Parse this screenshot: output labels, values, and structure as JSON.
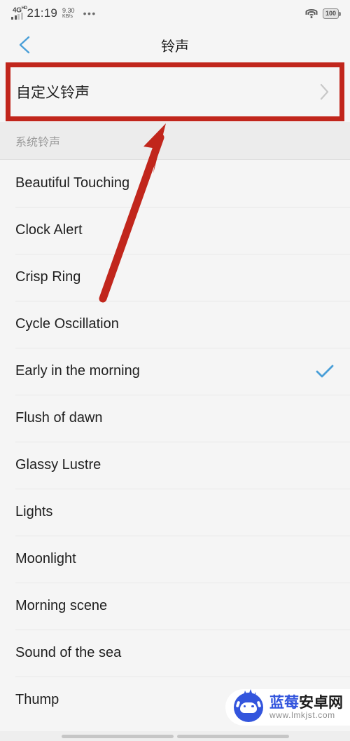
{
  "status_bar": {
    "network_type": "4G",
    "network_type_sup": "HD",
    "time": "21:19",
    "net_speed_value": "9.30",
    "net_speed_unit": "KB/s",
    "overflow_dots": "•••",
    "battery_level": "100"
  },
  "header": {
    "title": "铃声",
    "back_icon": "chevron-left-icon"
  },
  "custom_ringtone": {
    "label": "自定义铃声",
    "chevron_icon": "chevron-right-icon",
    "highlight_color": "#c1261c"
  },
  "section": {
    "title": "系统铃声"
  },
  "ringtones": [
    {
      "name": "Beautiful Touching",
      "selected": false
    },
    {
      "name": "Clock Alert",
      "selected": false
    },
    {
      "name": "Crisp Ring",
      "selected": false
    },
    {
      "name": "Cycle Oscillation",
      "selected": false
    },
    {
      "name": "Early in the morning",
      "selected": true
    },
    {
      "name": "Flush of dawn",
      "selected": false
    },
    {
      "name": "Glassy Lustre",
      "selected": false
    },
    {
      "name": "Lights",
      "selected": false
    },
    {
      "name": "Moonlight",
      "selected": false
    },
    {
      "name": "Morning scene",
      "selected": false
    },
    {
      "name": "Sound of the sea",
      "selected": false
    },
    {
      "name": "Thump",
      "selected": false
    }
  ],
  "annotation": {
    "arrow_icon": "red-arrow-up-right",
    "arrow_color": "#c1261c",
    "box_icon": "red-highlight-box"
  },
  "selection": {
    "check_icon": "checkmark-icon",
    "check_color": "#4a9fd8"
  },
  "watermark": {
    "brand_blue": "蓝莓",
    "brand_dark": "安卓网",
    "url": "www.lmkjst.com",
    "logo_icon": "android-mascot-icon"
  }
}
